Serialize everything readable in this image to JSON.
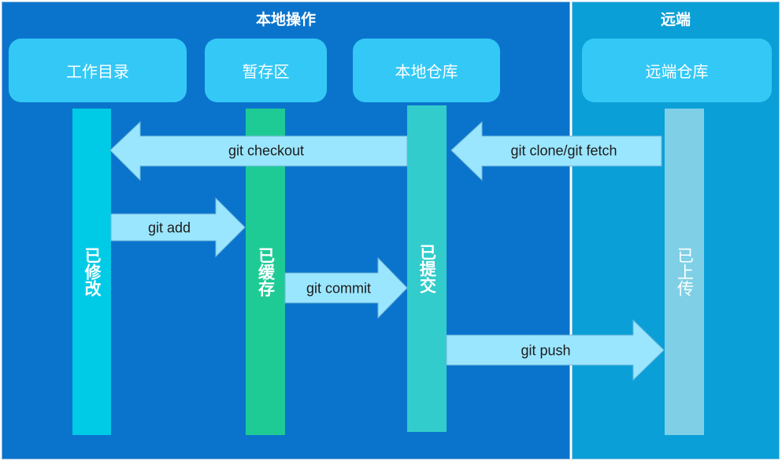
{
  "sections": {
    "local": "本地操作",
    "remote": "远端"
  },
  "stages": {
    "working_dir": "工作目录",
    "staging": "暂存区",
    "local_repo": "本地仓库",
    "remote_repo": "远端仓库"
  },
  "states": {
    "modified": "已修改",
    "staged": "已缓存",
    "committed": "已提交",
    "uploaded": "已上传"
  },
  "commands": {
    "checkout": "git checkout",
    "clone_fetch": "git clone/git fetch",
    "add": "git add",
    "commit": "git commit",
    "push": "git push"
  },
  "colors": {
    "local_bg": "#0a74cd",
    "remote_bg": "#0b9fd8",
    "stage_box": "#34c8f6",
    "modified": "#00cbe6",
    "staged": "#1fcb95",
    "committed": "#33cccc",
    "uploaded": "#7fd0e6",
    "arrow": "#9be6ff"
  }
}
